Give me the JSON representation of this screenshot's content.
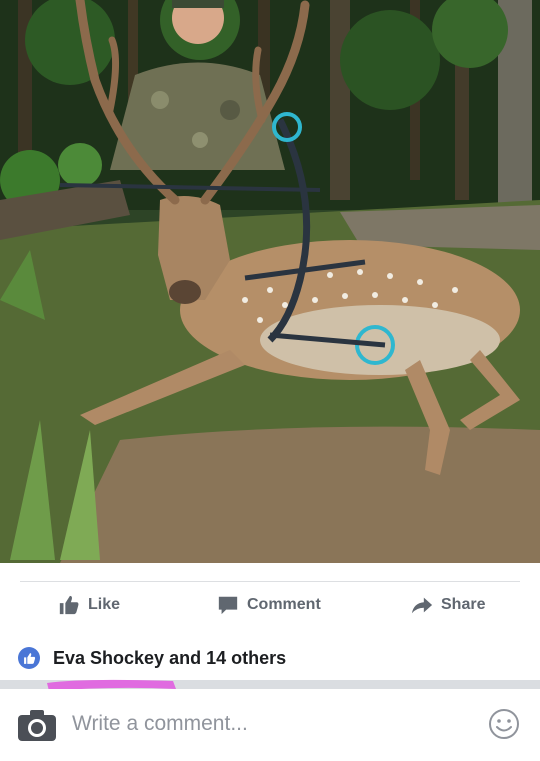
{
  "post_photo": {
    "alt": "",
    "palette": {
      "foliage": "#2a4a24",
      "dirt": "#7b6a52",
      "deer": "#b58f68",
      "bow_accent": "#2fb7cf"
    }
  },
  "actions": {
    "like_label": "Like",
    "comment_label": "Comment",
    "share_label": "Share",
    "like_icon": "thumbs-up-icon",
    "comment_icon": "speech-bubble-icon",
    "share_icon": "share-arrow-icon"
  },
  "reactions": {
    "summary": "Eva Shockey and 14 others",
    "badge_icon": "like-badge-icon",
    "badge_color": "#4a76d6"
  },
  "composer": {
    "placeholder": "Write a comment...",
    "camera_icon": "camera-icon",
    "emoji_icon": "smiley-icon"
  },
  "colors": {
    "action_text": "#606770",
    "name_text": "#1c1e21",
    "placeholder_text": "#90949c",
    "highlight": "#e06be0"
  }
}
